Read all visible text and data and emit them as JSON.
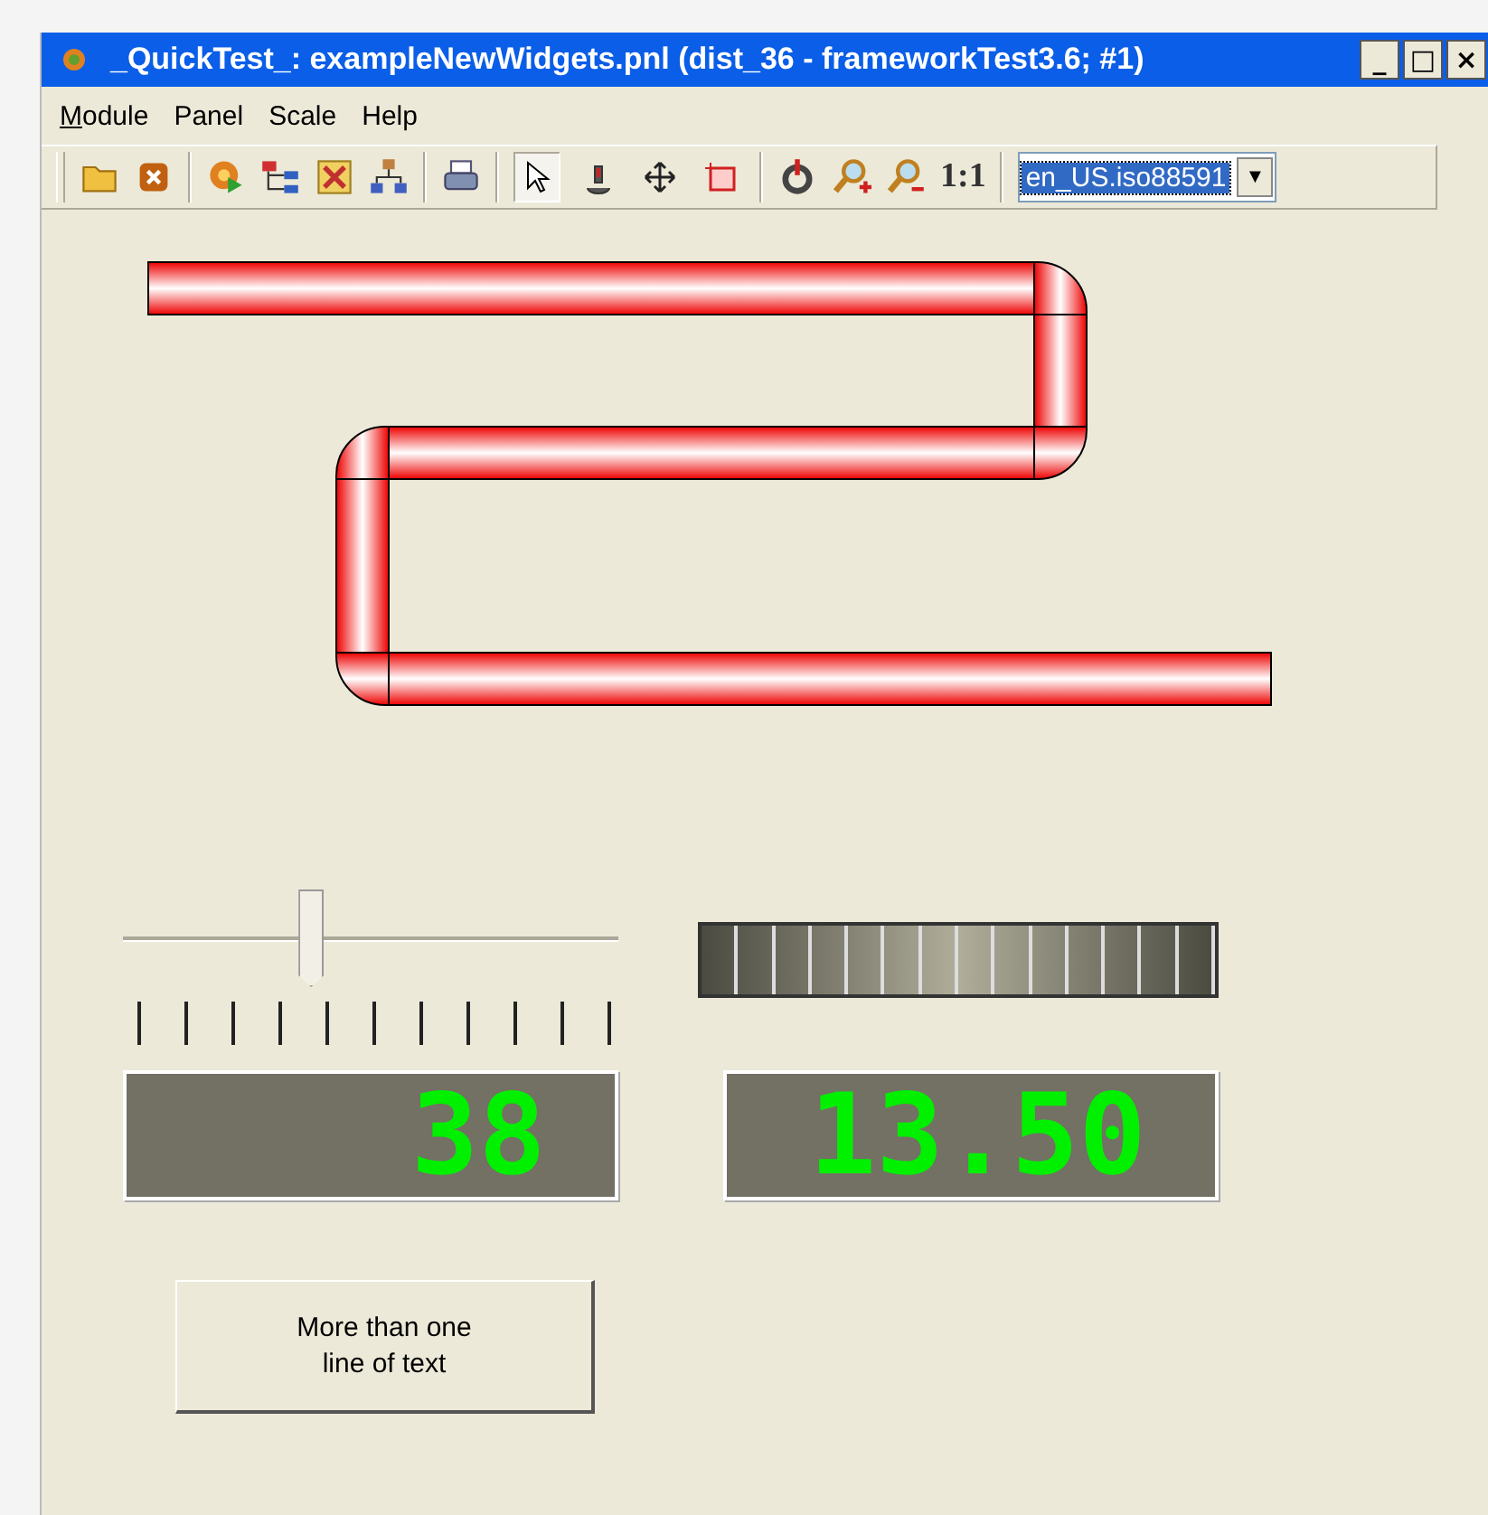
{
  "window": {
    "title": "_QuickTest_: exampleNewWidgets.pnl (dist_36 - frameworkTest3.6; #1)",
    "controls": [
      "_",
      "□",
      "×"
    ]
  },
  "menu": [
    {
      "label": "Module",
      "mnemonic": true
    },
    {
      "label": "Panel",
      "mnemonic": false
    },
    {
      "label": "Scale",
      "mnemonic": false
    },
    {
      "label": "Help",
      "mnemonic": false
    }
  ],
  "toolbar": {
    "edit_tools": [
      {
        "selected": true
      },
      {
        "selected": false
      },
      {
        "selected": false
      },
      {
        "selected": false
      }
    ],
    "zoom_reset": "1:1",
    "locale": {
      "value": "en_US.iso88591",
      "arrow": "▼"
    }
  },
  "slider": {
    "level": 0.38
  },
  "lcds": [
    {
      "value": "38"
    },
    {
      "value": "13.50"
    }
  ],
  "button": {
    "lines": [
      "More than one",
      "line of text"
    ]
  }
}
